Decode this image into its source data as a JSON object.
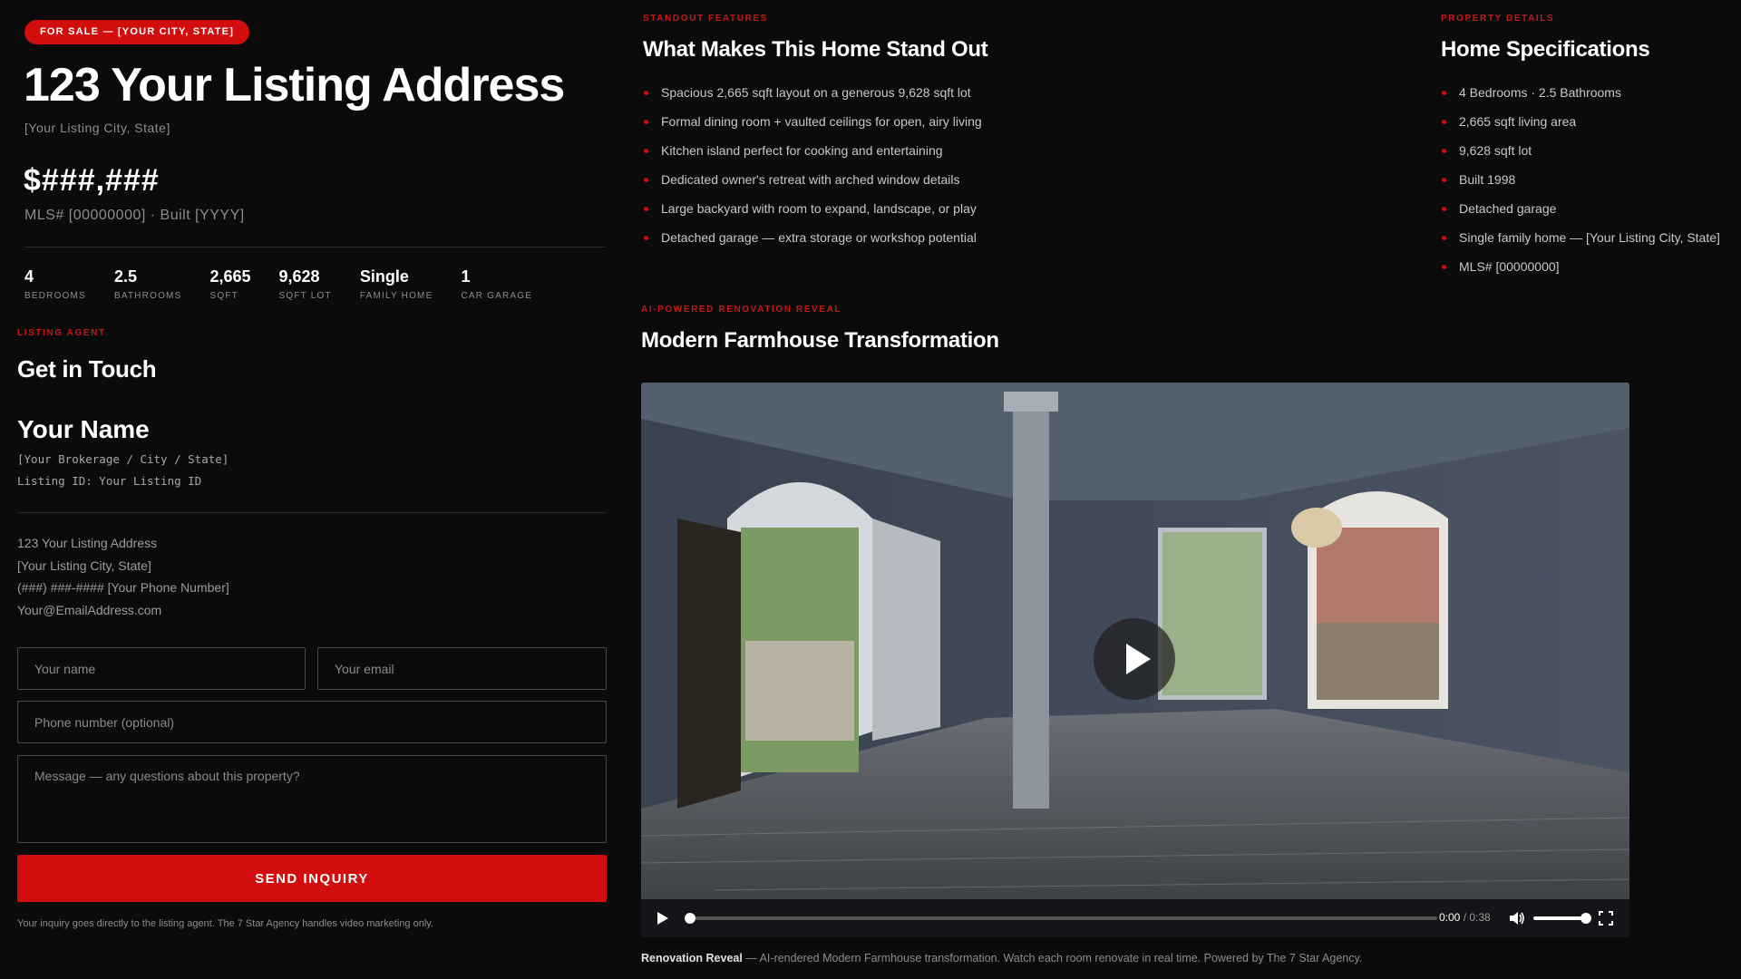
{
  "listing": {
    "badge": "FOR SALE — [YOUR CITY, STATE]",
    "address": "123 Your Listing Address",
    "city_state": "[Your Listing City, State]",
    "price": "$###,###",
    "mls_built": "MLS# [00000000] · Built [YYYY]"
  },
  "stats": [
    {
      "value": "4",
      "label": "BEDROOMS"
    },
    {
      "value": "2.5",
      "label": "BATHROOMS"
    },
    {
      "value": "2,665",
      "label": "SQFT"
    },
    {
      "value": "9,628",
      "label": "SQFT LOT"
    },
    {
      "value": "Single",
      "label": "FAMILY HOME"
    },
    {
      "value": "1",
      "label": "CAR GARAGE"
    }
  ],
  "agent": {
    "eyebrow": "LISTING AGENT",
    "heading": "Get in Touch",
    "name": "Your Name",
    "brokerage": "[Your Brokerage / City / State]",
    "listing_id": "Listing ID: Your Listing ID",
    "address_line1": "123 Your Listing Address",
    "address_line2": "[Your Listing City, State]",
    "phone": "(###) ###-#### [Your Phone Number]",
    "email": "Your@EmailAddress.com"
  },
  "form": {
    "name_placeholder": "Your name",
    "email_placeholder": "Your email",
    "phone_placeholder": "Phone number (optional)",
    "message_placeholder": "Message — any questions about this property?",
    "submit_label": "SEND INQUIRY",
    "fine_print": "Your inquiry goes directly to the listing agent. The 7 Star Agency handles video marketing only."
  },
  "features": {
    "eyebrow": "STANDOUT FEATURES",
    "heading": "What Makes This Home Stand Out",
    "items": [
      "Spacious 2,665 sqft layout on a generous 9,628 sqft lot",
      "Formal dining room + vaulted ceilings for open, airy living",
      "Kitchen island perfect for cooking and entertaining",
      "Dedicated owner's retreat with arched window details",
      "Large backyard with room to expand, landscape, or play",
      "Detached garage — extra storage or workshop potential"
    ]
  },
  "specs": {
    "eyebrow": "PROPERTY DETAILS",
    "heading": "Home Specifications",
    "items": [
      "4 Bedrooms · 2.5 Bathrooms",
      "2,665 sqft living area",
      "9,628 sqft lot",
      "Built 1998",
      "Detached garage",
      "Single family home — [Your Listing City, State]",
      "MLS# [00000000]"
    ]
  },
  "video": {
    "eyebrow": "AI-POWERED RENOVATION REVEAL",
    "heading": "Modern Farmhouse Transformation",
    "current_time": "0:00",
    "separator": " / ",
    "duration": "0:38",
    "progress": 0,
    "volume": 1.0,
    "caption_bold": "Renovation Reveal",
    "caption_text": " — AI-rendered Modern Farmhouse transformation. Watch each room renovate in real time. Powered by The 7 Star Agency."
  },
  "colors": {
    "accent": "#d10d0d",
    "background": "#0b0b0c"
  },
  "icons": [
    "play-icon",
    "volume-icon",
    "fullscreen-icon"
  ]
}
